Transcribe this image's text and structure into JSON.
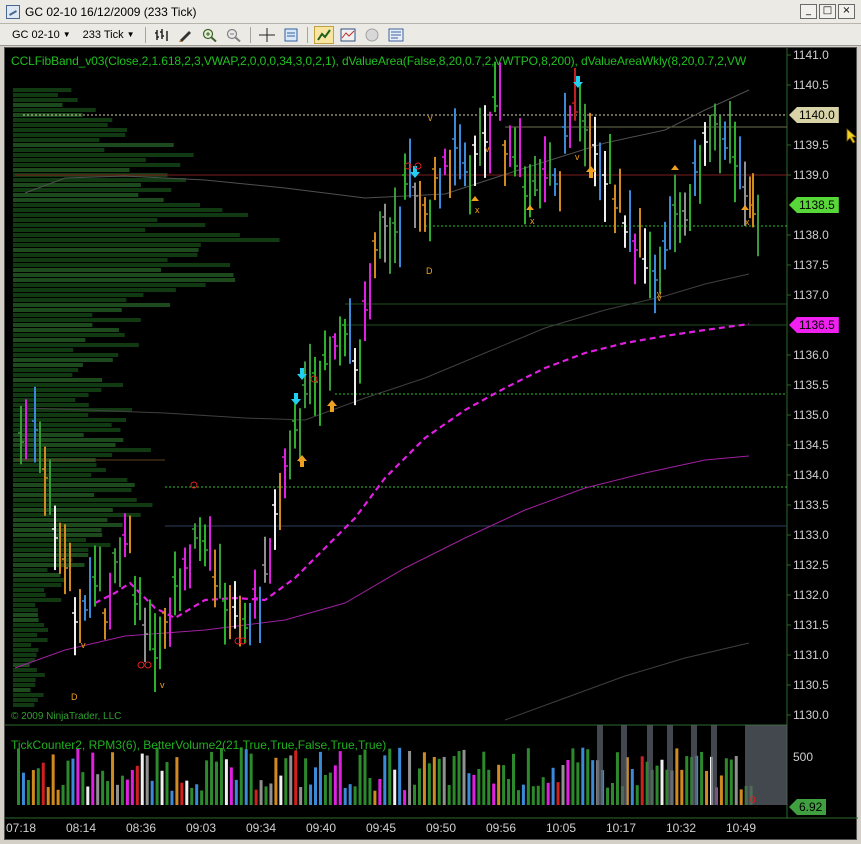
{
  "window": {
    "title": "GC 02-10  16/12/2009 (233 Tick)",
    "min_glyph": "_",
    "max_glyph": "□",
    "close_glyph": "×"
  },
  "toolbar": {
    "instrument": "GC 02-10",
    "interval": "233 Tick",
    "icons": [
      "bar-type-icon",
      "drawing-tool-icon",
      "zoom-in-icon",
      "zoom-out-icon",
      "crosshair-icon",
      "data-box-icon",
      "chart-trader-icon",
      "indicators-icon",
      "strategies-icon",
      "properties-icon"
    ]
  },
  "indicators_label": "CCLFibBand_v03(Close,2,1.618,2,3,VWAP,2,0,0,0,34,3,0,2,1),  dValueArea(False,8,20,0.7,2,VWTPO,8,200),  dValueAreaWkly(8,20,0.7,2,VW",
  "copyright": "© 2009 NinjaTrader, LLC",
  "panel2_label": "TickCounter2,  RPM3(6),  BetterVolume2(21,True,True,False,True,True)",
  "price_axis": {
    "ticks": [
      "1141.0",
      "1140.5",
      "1139.5",
      "1139.0",
      "1138.0",
      "1137.5",
      "1137.0",
      "1136.0",
      "1135.5",
      "1135.0",
      "1134.5",
      "1134.0",
      "1133.5",
      "1133.0",
      "1132.5",
      "1132.0",
      "1131.5",
      "1131.0",
      "1130.5",
      "1130.0"
    ],
    "tags": [
      {
        "label": "1140.0",
        "color": "#d8d4a8"
      },
      {
        "label": "1138.5",
        "color": "#58d838"
      },
      {
        "label": "1136.5",
        "color": "#f020f0"
      }
    ]
  },
  "volume_axis": {
    "tick": "500",
    "tag": "6.92",
    "tag_color": "#40a040"
  },
  "time_axis": [
    "07:18",
    "08:14",
    "08:36",
    "09:03",
    "09:34",
    "09:40",
    "09:45",
    "09:50",
    "09:56",
    "10:05",
    "10:17",
    "10:32",
    "10:49"
  ],
  "markers": {
    "v": "v",
    "x": "x",
    "d": "D"
  }
}
